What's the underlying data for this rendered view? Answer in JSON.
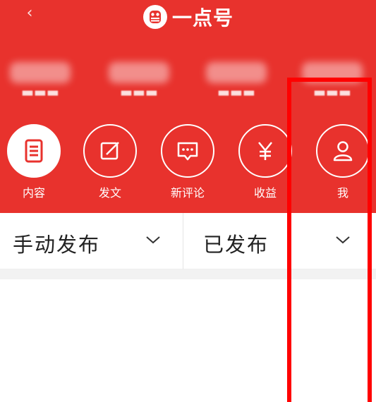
{
  "app": {
    "logo_text": "一点号",
    "back_icon": "chevron-left-icon",
    "brand_color": "#e8322d",
    "highlight_color": "#ff0000"
  },
  "nav": {
    "items": [
      {
        "label": "内容",
        "icon": "document-icon",
        "active": true
      },
      {
        "label": "发文",
        "icon": "edit-icon",
        "active": false
      },
      {
        "label": "新评论",
        "icon": "comment-icon",
        "active": false
      },
      {
        "label": "收益",
        "icon": "yen-icon",
        "active": false
      },
      {
        "label": "我",
        "icon": "user-icon",
        "active": false
      }
    ]
  },
  "filters": {
    "publish_mode": "手动发布",
    "status": "已发布"
  }
}
